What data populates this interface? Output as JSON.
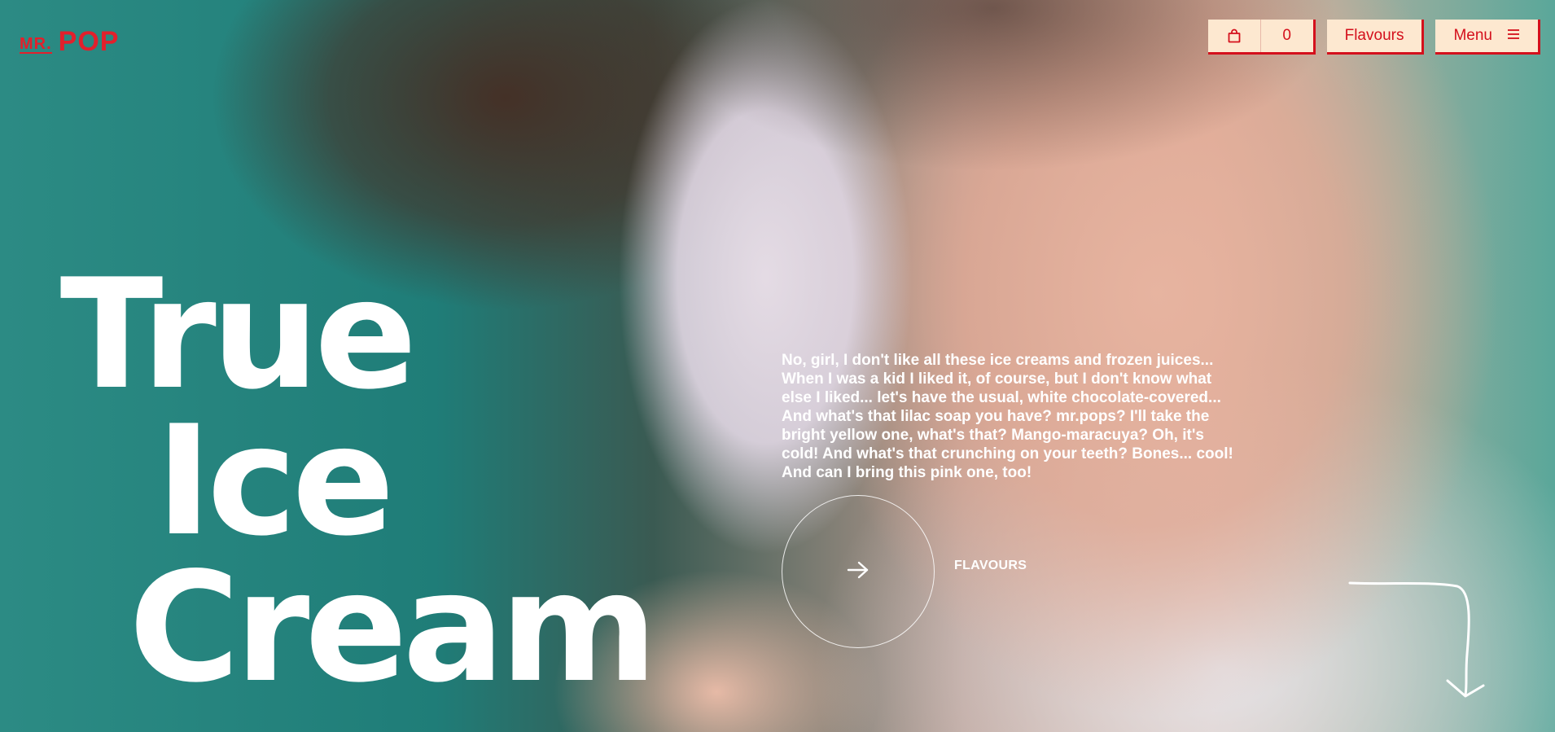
{
  "brand": {
    "mr": "MR.",
    "pop": "POP"
  },
  "nav": {
    "cart_count": "0",
    "flavours_label": "Flavours",
    "menu_label": "Menu"
  },
  "hero": {
    "title_lines": [
      "True",
      "Ice",
      "Cream"
    ],
    "quote": "No, girl, I don't like all these ice creams and frozen juices... When I was a kid I liked it, of course, but I don't know what else I liked... let's have the usual, white chocolate-covered... And what's that lilac soap you have? mr.pops? I'll take the bright yellow one, what's that? Mango-maracuya? Oh, it's cold! And what's that crunching on your teeth? Bones... cool! And can I bring this pink one, too!",
    "cta_label": "FLAVOURS"
  },
  "icons": {
    "cart": "shopping-bag-icon",
    "menu": "hamburger-icon",
    "cta": "arrow-right-icon",
    "scroll": "scroll-down-arrow-icon"
  },
  "colors": {
    "brand_red": "#e2202c",
    "pill_bg": "#fde8d0",
    "text_on_photo": "#ffffff"
  }
}
